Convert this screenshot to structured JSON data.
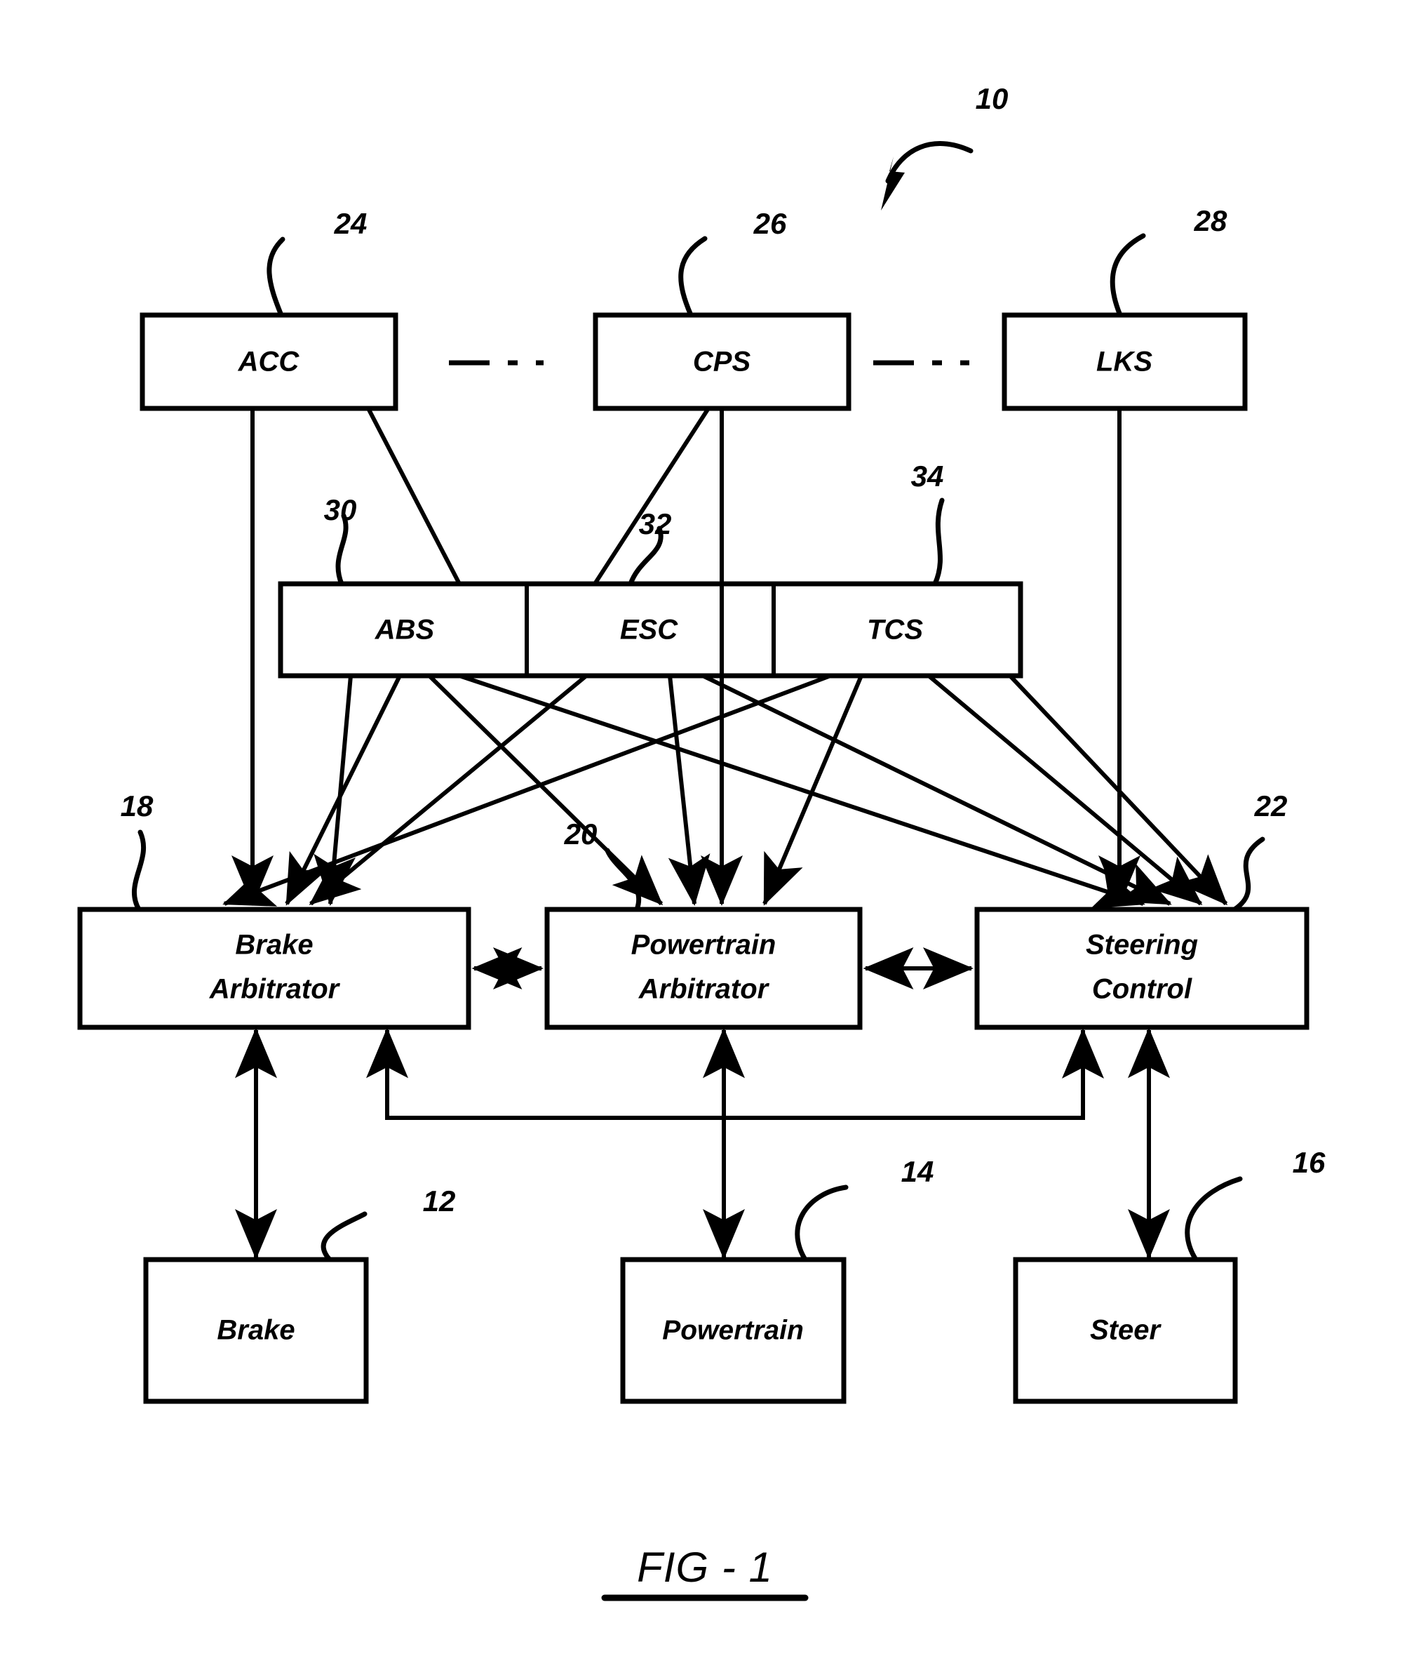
{
  "figure": {
    "caption": "FIG - 1",
    "system_ref": "10"
  },
  "nodes": {
    "top_row": [
      {
        "id": "acc",
        "label": "ACC",
        "ref": "24"
      },
      {
        "id": "cps",
        "label": "CPS",
        "ref": "26"
      },
      {
        "id": "lks",
        "label": "LKS",
        "ref": "28"
      }
    ],
    "middle_row": [
      {
        "id": "abs",
        "label": "ABS",
        "ref": "30"
      },
      {
        "id": "esc",
        "label": "ESC",
        "ref": "32"
      },
      {
        "id": "tcs",
        "label": "TCS",
        "ref": "34"
      }
    ],
    "arbitrator_row": [
      {
        "id": "brake_arbitrator",
        "label_line1": "Brake",
        "label_line2": "Arbitrator",
        "ref": "18"
      },
      {
        "id": "powertrain_arbitrator",
        "label_line1": "Powertrain",
        "label_line2": "Arbitrator",
        "ref": "20"
      },
      {
        "id": "steering_control",
        "label_line1": "Steering",
        "label_line2": "Control",
        "ref": "22"
      }
    ],
    "actuator_row": [
      {
        "id": "brake",
        "label": "Brake",
        "ref": "12"
      },
      {
        "id": "powertrain",
        "label": "Powertrain",
        "ref": "14"
      },
      {
        "id": "steer",
        "label": "Steer",
        "ref": "16"
      }
    ]
  },
  "colors": {
    "stroke": "#000000",
    "fill": "#ffffff",
    "background": "#ffffff"
  }
}
